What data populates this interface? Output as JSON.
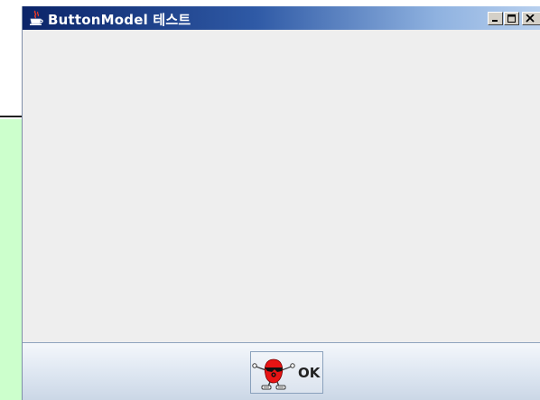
{
  "window": {
    "title": "ButtonModel 테스트",
    "icon": "java-cup-icon",
    "controls": [
      "minimize-icon",
      "maximize-icon",
      "close-icon"
    ]
  },
  "south_panel": {
    "ok_button": {
      "label": "OK",
      "icon": "duke-mascot-icon"
    }
  },
  "colors": {
    "titlebar_start": "#0b2468",
    "titlebar_end": "#b8d0ee",
    "content_bg": "#eeeeee",
    "background_panel": "#ccffcc"
  }
}
